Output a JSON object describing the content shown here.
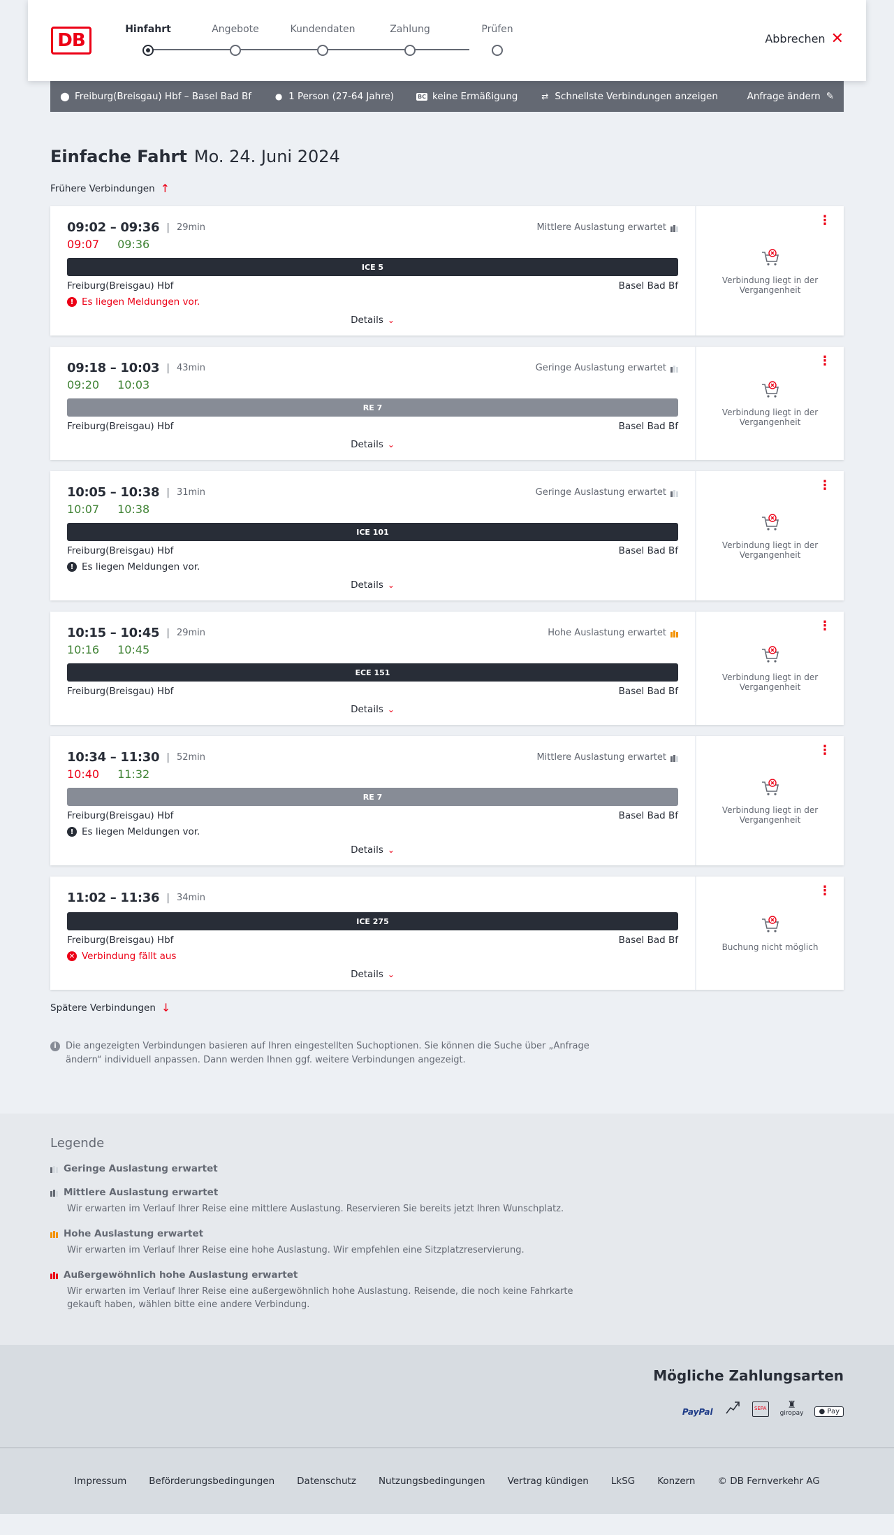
{
  "header": {
    "logo": "DB",
    "steps": [
      "Hinfahrt",
      "Angebote",
      "Kundendaten",
      "Zahlung",
      "Prüfen"
    ],
    "active_step": "Hinfahrt",
    "cancel_label": "Abbrechen"
  },
  "request": {
    "route": "Freiburg(Breisgau) Hbf – Basel Bad Bf",
    "passengers": "1 Person (27-64 Jahre)",
    "discount": "keine Ermäßigung",
    "discount_badge": "BC",
    "option": "Schnellste Verbindungen anzeigen",
    "change_label": "Anfrage ändern"
  },
  "trip": {
    "title": "Einfache Fahrt",
    "date": "Mo. 24. Juni 2024",
    "earlier_label": "Frühere Verbindungen",
    "later_label": "Spätere Verbindungen",
    "details_label": "Details"
  },
  "connections": [
    {
      "times": "09:02 – 09:36",
      "duration": "29min",
      "load": "Mittlere Auslastung erwartet",
      "load_level": "mid",
      "rt_dep": "09:07",
      "rt_dep_late": true,
      "rt_arr": "09:36",
      "rt_arr_late": false,
      "train": "ICE 5",
      "bar": "dark",
      "from": "Freiburg(Breisgau) Hbf",
      "to": "Basel Bad Bf",
      "message": "Es liegen Meldungen vor.",
      "message_type": "red",
      "side_text": "Verbindung liegt in der Vergangenheit"
    },
    {
      "times": "09:18 – 10:03",
      "duration": "43min",
      "load": "Geringe Auslastung erwartet",
      "load_level": "low",
      "rt_dep": "09:20",
      "rt_dep_late": false,
      "rt_arr": "10:03",
      "rt_arr_late": false,
      "train": "RE 7",
      "bar": "grey",
      "from": "Freiburg(Breisgau) Hbf",
      "to": "Basel Bad Bf",
      "message": "",
      "message_type": "",
      "side_text": "Verbindung liegt in der Vergangenheit"
    },
    {
      "times": "10:05 – 10:38",
      "duration": "31min",
      "load": "Geringe Auslastung erwartet",
      "load_level": "low",
      "rt_dep": "10:07",
      "rt_dep_late": false,
      "rt_arr": "10:38",
      "rt_arr_late": false,
      "train": "ICE 101",
      "bar": "dark",
      "from": "Freiburg(Breisgau) Hbf",
      "to": "Basel Bad Bf",
      "message": "Es liegen Meldungen vor.",
      "message_type": "dark",
      "side_text": "Verbindung liegt in der Vergangenheit"
    },
    {
      "times": "10:15 – 10:45",
      "duration": "29min",
      "load": "Hohe Auslastung erwartet",
      "load_level": "high",
      "rt_dep": "10:16",
      "rt_dep_late": false,
      "rt_arr": "10:45",
      "rt_arr_late": false,
      "train": "ECE 151",
      "bar": "dark",
      "from": "Freiburg(Breisgau) Hbf",
      "to": "Basel Bad Bf",
      "message": "",
      "message_type": "",
      "side_text": "Verbindung liegt in der Vergangenheit"
    },
    {
      "times": "10:34 – 11:30",
      "duration": "52min",
      "load": "Mittlere Auslastung erwartet",
      "load_level": "mid",
      "rt_dep": "10:40",
      "rt_dep_late": true,
      "rt_arr": "11:32",
      "rt_arr_late": false,
      "train": "RE 7",
      "bar": "grey",
      "from": "Freiburg(Breisgau) Hbf",
      "to": "Basel Bad Bf",
      "message": "Es liegen Meldungen vor.",
      "message_type": "dark",
      "side_text": "Verbindung liegt in der Vergangenheit"
    },
    {
      "times": "11:02 – 11:36",
      "duration": "34min",
      "load": "",
      "load_level": "",
      "rt_dep": "",
      "rt_dep_late": false,
      "rt_arr": "",
      "rt_arr_late": false,
      "train": "ICE 275",
      "bar": "dark",
      "from": "Freiburg(Breisgau) Hbf",
      "to": "Basel Bad Bf",
      "message": "Verbindung fällt aus",
      "message_type": "cancel",
      "side_text": "Buchung nicht möglich"
    }
  ],
  "info_text": "Die angezeigten Verbindungen basieren auf Ihren eingestellten Suchoptionen. Sie können die Suche über „Anfrage ändern“ individuell anpassen. Dann werden Ihnen ggf. weitere Verbindungen angezeigt.",
  "legend": {
    "title": "Legende",
    "items": [
      {
        "level": "low",
        "title": "Geringe Auslastung erwartet",
        "text": ""
      },
      {
        "level": "mid",
        "title": "Mittlere Auslastung erwartet",
        "text": "Wir erwarten im Verlauf Ihrer Reise eine mittlere Auslastung. Reservieren Sie bereits jetzt Ihren Wunschplatz."
      },
      {
        "level": "high",
        "title": "Hohe Auslastung erwartet",
        "text": "Wir erwarten im Verlauf Ihrer Reise eine hohe Auslastung. Wir empfehlen eine Sitzplatzreservierung."
      },
      {
        "level": "ext",
        "title": "Außergewöhnlich hohe Auslastung erwartet",
        "text": "Wir erwarten im Verlauf Ihrer Reise eine außergewöhnlich hohe Auslastung. Reisende, die noch keine Fahrkarte gekauft haben, wählen bitte eine andere Verbindung."
      }
    ]
  },
  "payment": {
    "title": "Mögliche Zahlungsarten",
    "methods": [
      "PayPal",
      "Kreditkarte",
      "SEPA",
      "giropay",
      "Apple Pay"
    ],
    "labels": {
      "paypal": "PayPal",
      "sepa": "SEPA",
      "giropay": "giropay",
      "applepay": "Pay"
    }
  },
  "footer": {
    "links": [
      "Impressum",
      "Beförderungsbedingungen",
      "Datenschutz",
      "Nutzungsbedingungen",
      "Vertrag kündigen",
      "LkSG",
      "Konzern",
      "© DB Fernverkehr AG"
    ]
  },
  "colors": {
    "brand": "#ec0016",
    "delay": "#ec0016",
    "ontime": "#408335",
    "high_load": "#f39200"
  }
}
